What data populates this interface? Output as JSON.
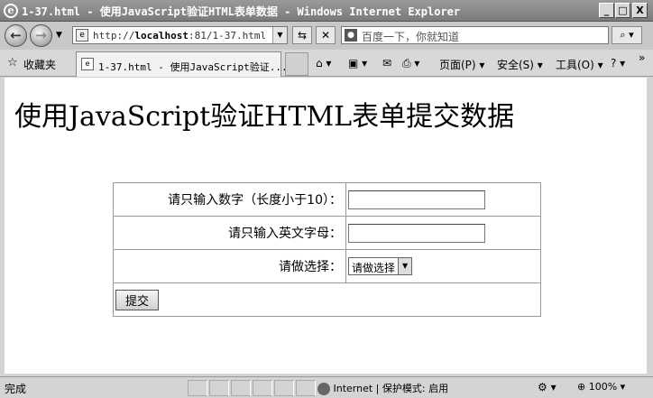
{
  "window": {
    "title": "1-37.html - 使用JavaScript验证HTML表单数据 - Windows Internet Explorer",
    "min_label": "_",
    "max_label": "□",
    "close_label": "X"
  },
  "address": {
    "url_prefix": "http://",
    "url_host": "localhost",
    "url_rest": ":81/1-37.html",
    "search_placeholder": "百度一下，你就知道"
  },
  "favorites": {
    "label": "收藏夹",
    "tab_label": "1-37.html - 使用JavaScript验证..."
  },
  "commands": {
    "page": "页面(P)",
    "safety": "安全(S)",
    "tools": "工具(O)"
  },
  "page": {
    "heading": "使用JavaScript验证HTML表单提交数据",
    "form": {
      "number_label": "请只输入数字（长度小于10）：",
      "number_value": "",
      "letters_label": "请只输入英文字母：",
      "letters_value": "",
      "choice_label": "请做选择：",
      "choice_selected": "请做选择",
      "submit_label": "提交"
    }
  },
  "status": {
    "text": "完成",
    "zone": "Internet | 保护模式: 启用",
    "zoom": "100%"
  },
  "icons": [
    "ie-logo-icon",
    "back-arrow-icon",
    "forward-arrow-icon",
    "page-icon",
    "refresh-icon",
    "stop-icon",
    "baidu-icon",
    "search-icon",
    "star-icon",
    "home-icon",
    "feed-icon",
    "mail-icon",
    "print-icon",
    "help-icon",
    "globe-icon",
    "zoom-icon"
  ]
}
